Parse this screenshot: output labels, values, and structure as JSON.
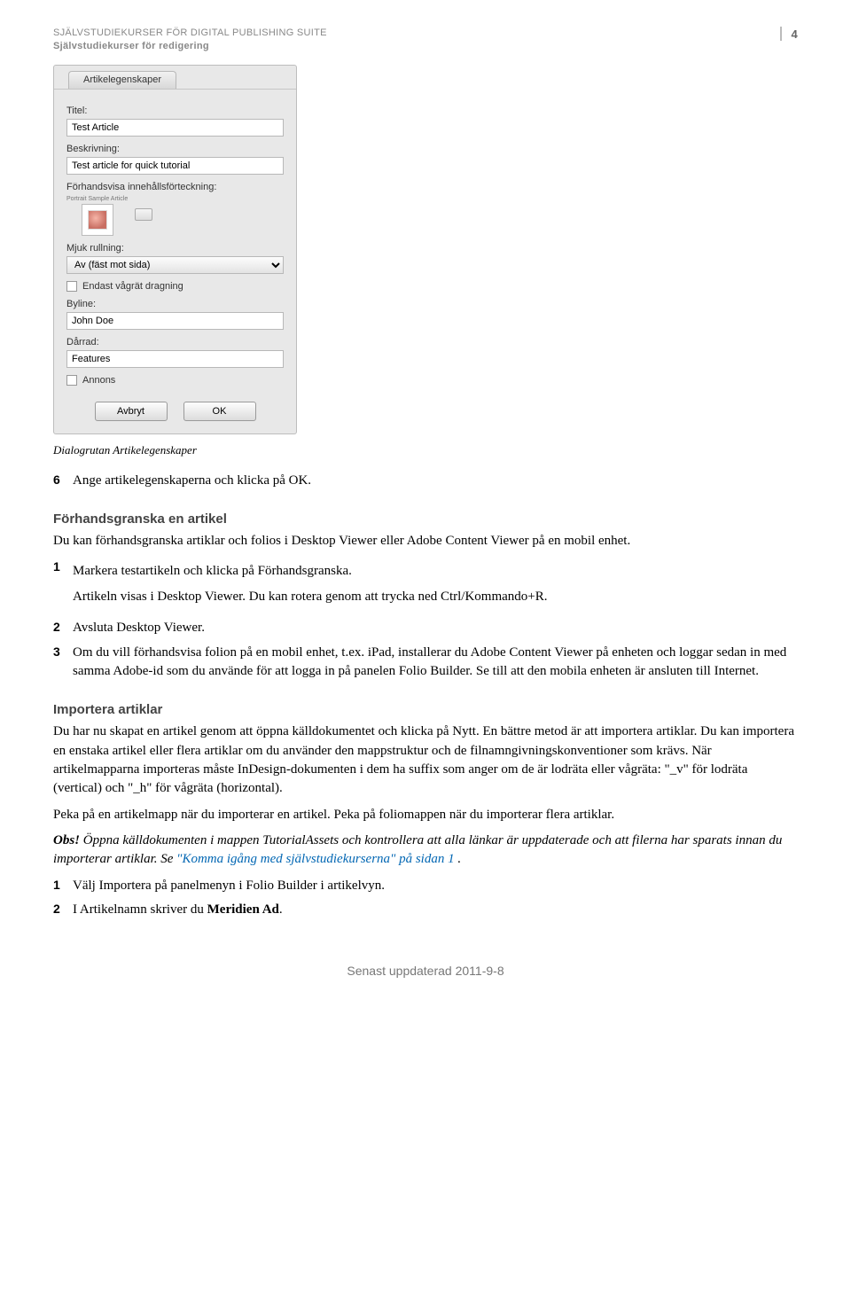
{
  "header": {
    "line1": "SJÄLVSTUDIEKURSER FÖR DIGITAL PUBLISHING SUITE",
    "line2": "Självstudiekurser för redigering",
    "page": "4"
  },
  "dialog": {
    "tab": "Artikelegenskaper",
    "titel_label": "Titel:",
    "titel_value": "Test Article",
    "beskrivning_label": "Beskrivning:",
    "beskrivning_value": "Test article for quick tutorial",
    "forhandsvisa_label": "Förhandsvisa innehållsförteckning:",
    "thumb_label": "Portrait Sample Article",
    "mjuk_label": "Mjuk rullning:",
    "mjuk_value": "Av (fäst mot sida)",
    "vagrat_label": "Endast vågrät dragning",
    "byline_label": "Byline:",
    "byline_value": "John Doe",
    "darrad_label": "Dårrad:",
    "darrad_value": "Features",
    "annons_label": "Annons",
    "cancel": "Avbryt",
    "ok": "OK"
  },
  "caption": "Dialogrutan Artikelegenskaper",
  "step6": {
    "num": "6",
    "text": "Ange artikelegenskaperna och klicka på OK."
  },
  "sec_forhands": {
    "head": "Förhandsgranska en artikel",
    "intro": "Du kan förhandsgranska artiklar och folios i Desktop Viewer eller Adobe Content Viewer på en mobil enhet.",
    "s1_num": "1",
    "s1a": "Markera testartikeln och klicka på Förhandsgranska.",
    "s1b": "Artikeln visas i Desktop Viewer. Du kan rotera genom att trycka ned Ctrl/Kommando+R.",
    "s2_num": "2",
    "s2": "Avsluta Desktop Viewer.",
    "s3_num": "3",
    "s3": "Om du vill förhandsvisa folion på en mobil enhet, t.ex. iPad, installerar du Adobe Content Viewer på enheten och loggar sedan in med samma Adobe-id som du använde för att logga in på panelen Folio Builder. Se till att den mobila enheten är ansluten till Internet."
  },
  "sec_import": {
    "head": "Importera artiklar",
    "p1": "Du har nu skapat en artikel genom att öppna källdokumentet och klicka på Nytt. En bättre metod är att importera artiklar. Du kan importera en enstaka artikel eller flera artiklar om du använder den mappstruktur och de filnamngivningskonventioner som krävs. När artikelmapparna importeras måste InDesign-dokumenten i dem ha suffix som anger om de är lodräta eller vågräta: \"_v\" för lodräta (vertical) och \"_h\" för vågräta (horizontal).",
    "p2": "Peka på en artikelmapp när du importerar en artikel. Peka på foliomappen när du importerar flera artiklar.",
    "obs_label": "Obs!",
    "obs_body": " Öppna källdokumenten i mappen TutorialAssets och kontrollera att alla länkar är uppdaterade och att filerna har sparats innan du importerar artiklar. Se ",
    "obs_link": "\"Komma igång med självstudiekurserna\" på sidan 1",
    "obs_tail": ".",
    "s1_num": "1",
    "s1": "Välj Importera på panelmenyn i Folio Builder i artikelvyn.",
    "s2_num": "2",
    "s2_a": "I Artikelnamn skriver du ",
    "s2_b": "Meridien Ad",
    "s2_c": "."
  },
  "footer": "Senast uppdaterad 2011-9-8"
}
